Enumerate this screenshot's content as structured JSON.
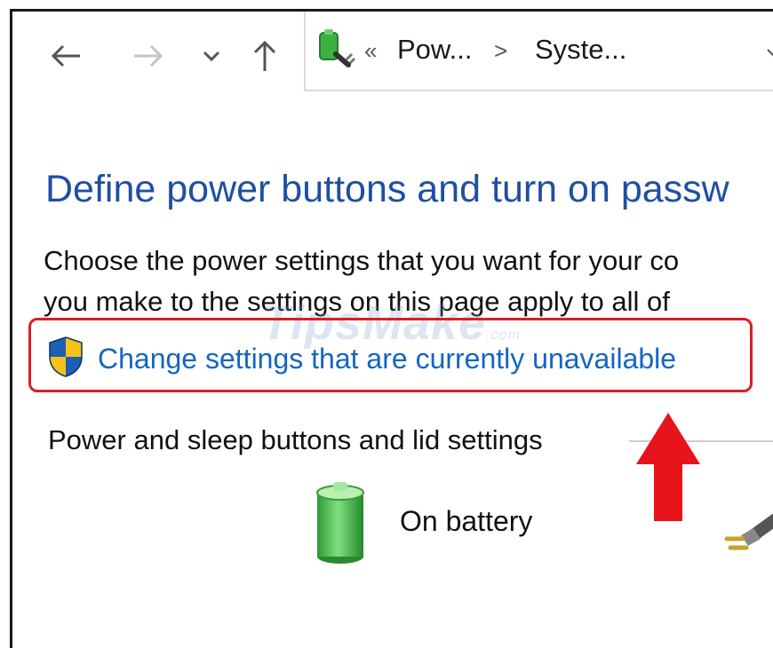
{
  "nav": {
    "back_icon": "arrow-left-icon",
    "forward_icon": "arrow-right-icon",
    "recent_icon": "chevron-down-icon",
    "up_icon": "arrow-up-icon"
  },
  "address_bar": {
    "icon": "power-options-icon",
    "overflow": "«",
    "crumbs": [
      "Pow...",
      "Syste..."
    ],
    "separator": ">"
  },
  "page": {
    "title": "Define power buttons and turn on passw",
    "description_line1": "Choose the power settings that you want for your co",
    "description_line2": "you make to the settings on this page apply to all of",
    "change_settings_link": "Change settings that are currently unavailable",
    "section_header": "Power and sleep buttons and lid settings",
    "on_battery_label": "On battery"
  },
  "watermark": {
    "brand": "TipsMake",
    "suffix": ".com"
  },
  "colors": {
    "title": "#1f4fa3",
    "link": "#1565c0",
    "highlight_box": "#d91f26",
    "arrow": "#e8141b",
    "battery": "#3cb043"
  }
}
